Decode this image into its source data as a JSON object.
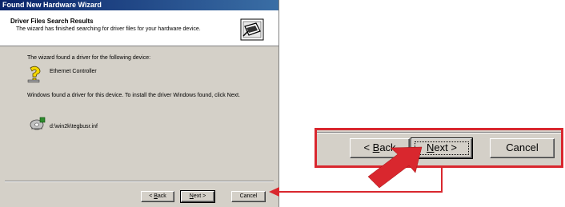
{
  "window": {
    "title": "Found New Hardware Wizard"
  },
  "header": {
    "title": "Driver Files Search Results",
    "subtitle": "The wizard has finished searching for driver files for your hardware device.",
    "icon": "hardware-wizard-icon"
  },
  "body": {
    "line1": "The wizard found a driver for the following device:",
    "device_name": "Ethernet Controller",
    "device_icon": "unknown-device-icon",
    "line2": "Windows found a driver for this device. To install the driver Windows found, click Next.",
    "driver_path": "d:\\win2k\\tegbusr.inf",
    "driver_icon": "driver-disk-icon"
  },
  "buttons": {
    "back": {
      "prefix": "< ",
      "key": "B",
      "rest": "ack"
    },
    "next": {
      "key": "N",
      "rest": "ext >"
    },
    "cancel": "Cancel"
  },
  "colors": {
    "titlebar": "#0a246a",
    "dialog": "#d4d0c8",
    "callout": "#d9272e"
  }
}
